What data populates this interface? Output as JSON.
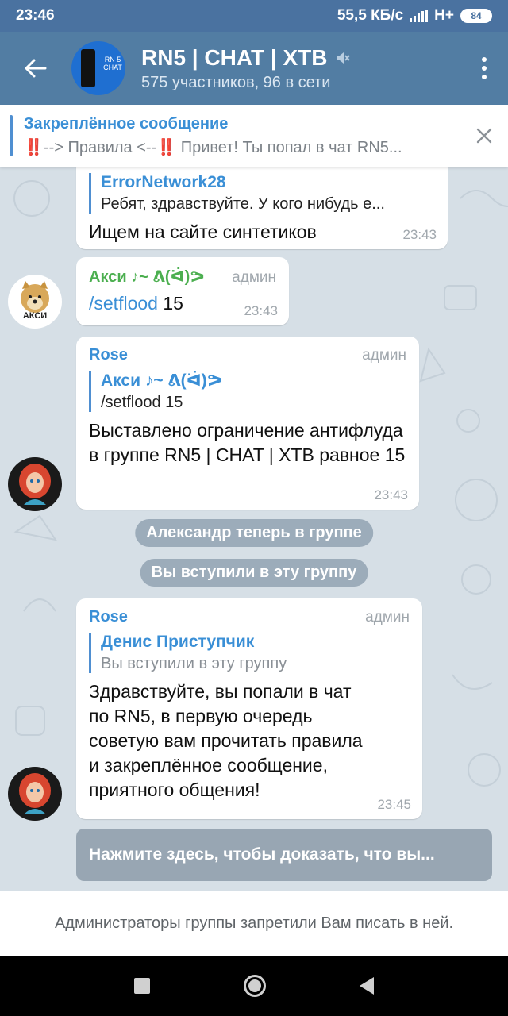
{
  "status": {
    "time": "23:46",
    "speed": "55,5 КБ/с",
    "network": "H+",
    "battery": "84"
  },
  "header": {
    "title": "RN5 | CHAT | XTB",
    "subtitle": "575 участников, 96 в сети",
    "avatar_text": "RN 5 CHAT"
  },
  "pinned": {
    "title": "Закреплённое сообщение",
    "bang": "‼️",
    "body": "--> Правила <--",
    "body2": " Привет! Ты попал в чат RN5..."
  },
  "messages": [
    {
      "reply_name": "ErrorNetwork28",
      "reply_text": "Ребят, здравствуйте. У кого нибудь е...",
      "text": "Ищем на сайте синтетиков",
      "time": "23:43"
    },
    {
      "sender": "Акси ♪~ ᕕ(ᐛ)ᕗ",
      "role": "админ",
      "cmd": "/setflood",
      "arg": " 15",
      "time": "23:43",
      "avatar_text": "АКСИ"
    },
    {
      "sender": "Rose",
      "role": "админ",
      "reply_name": "Акси ♪~ ᕕ(ᐛ)ᕗ",
      "reply_text": "/setflood 15",
      "text": "Выставлено ограничение антифлуда в группе RN5 | CHAT | XTB равное 15",
      "time": "23:43"
    },
    {
      "sender": "Rose",
      "role": "админ",
      "reply_name": "Денис Приступчик",
      "reply_text": "Вы вступили в эту группу",
      "text": "Здравствуйте, вы попали в чат по RN5, в первую очередь советую вам прочитать правила и закреплённое сообщение, приятного общения!",
      "time": "23:45"
    }
  ],
  "service": {
    "joined_other": "Александр теперь в группе",
    "joined_self": "Вы вступили в эту группу"
  },
  "captcha": "Нажмите здесь, чтобы доказать, что вы...",
  "notice": "Администраторы группы запретили Вам писать в ней.",
  "colors": {
    "header": "#527da3",
    "accent": "#3a8fd6",
    "green_name": "#4caf50",
    "chat_bg": "#d6dfe6"
  }
}
